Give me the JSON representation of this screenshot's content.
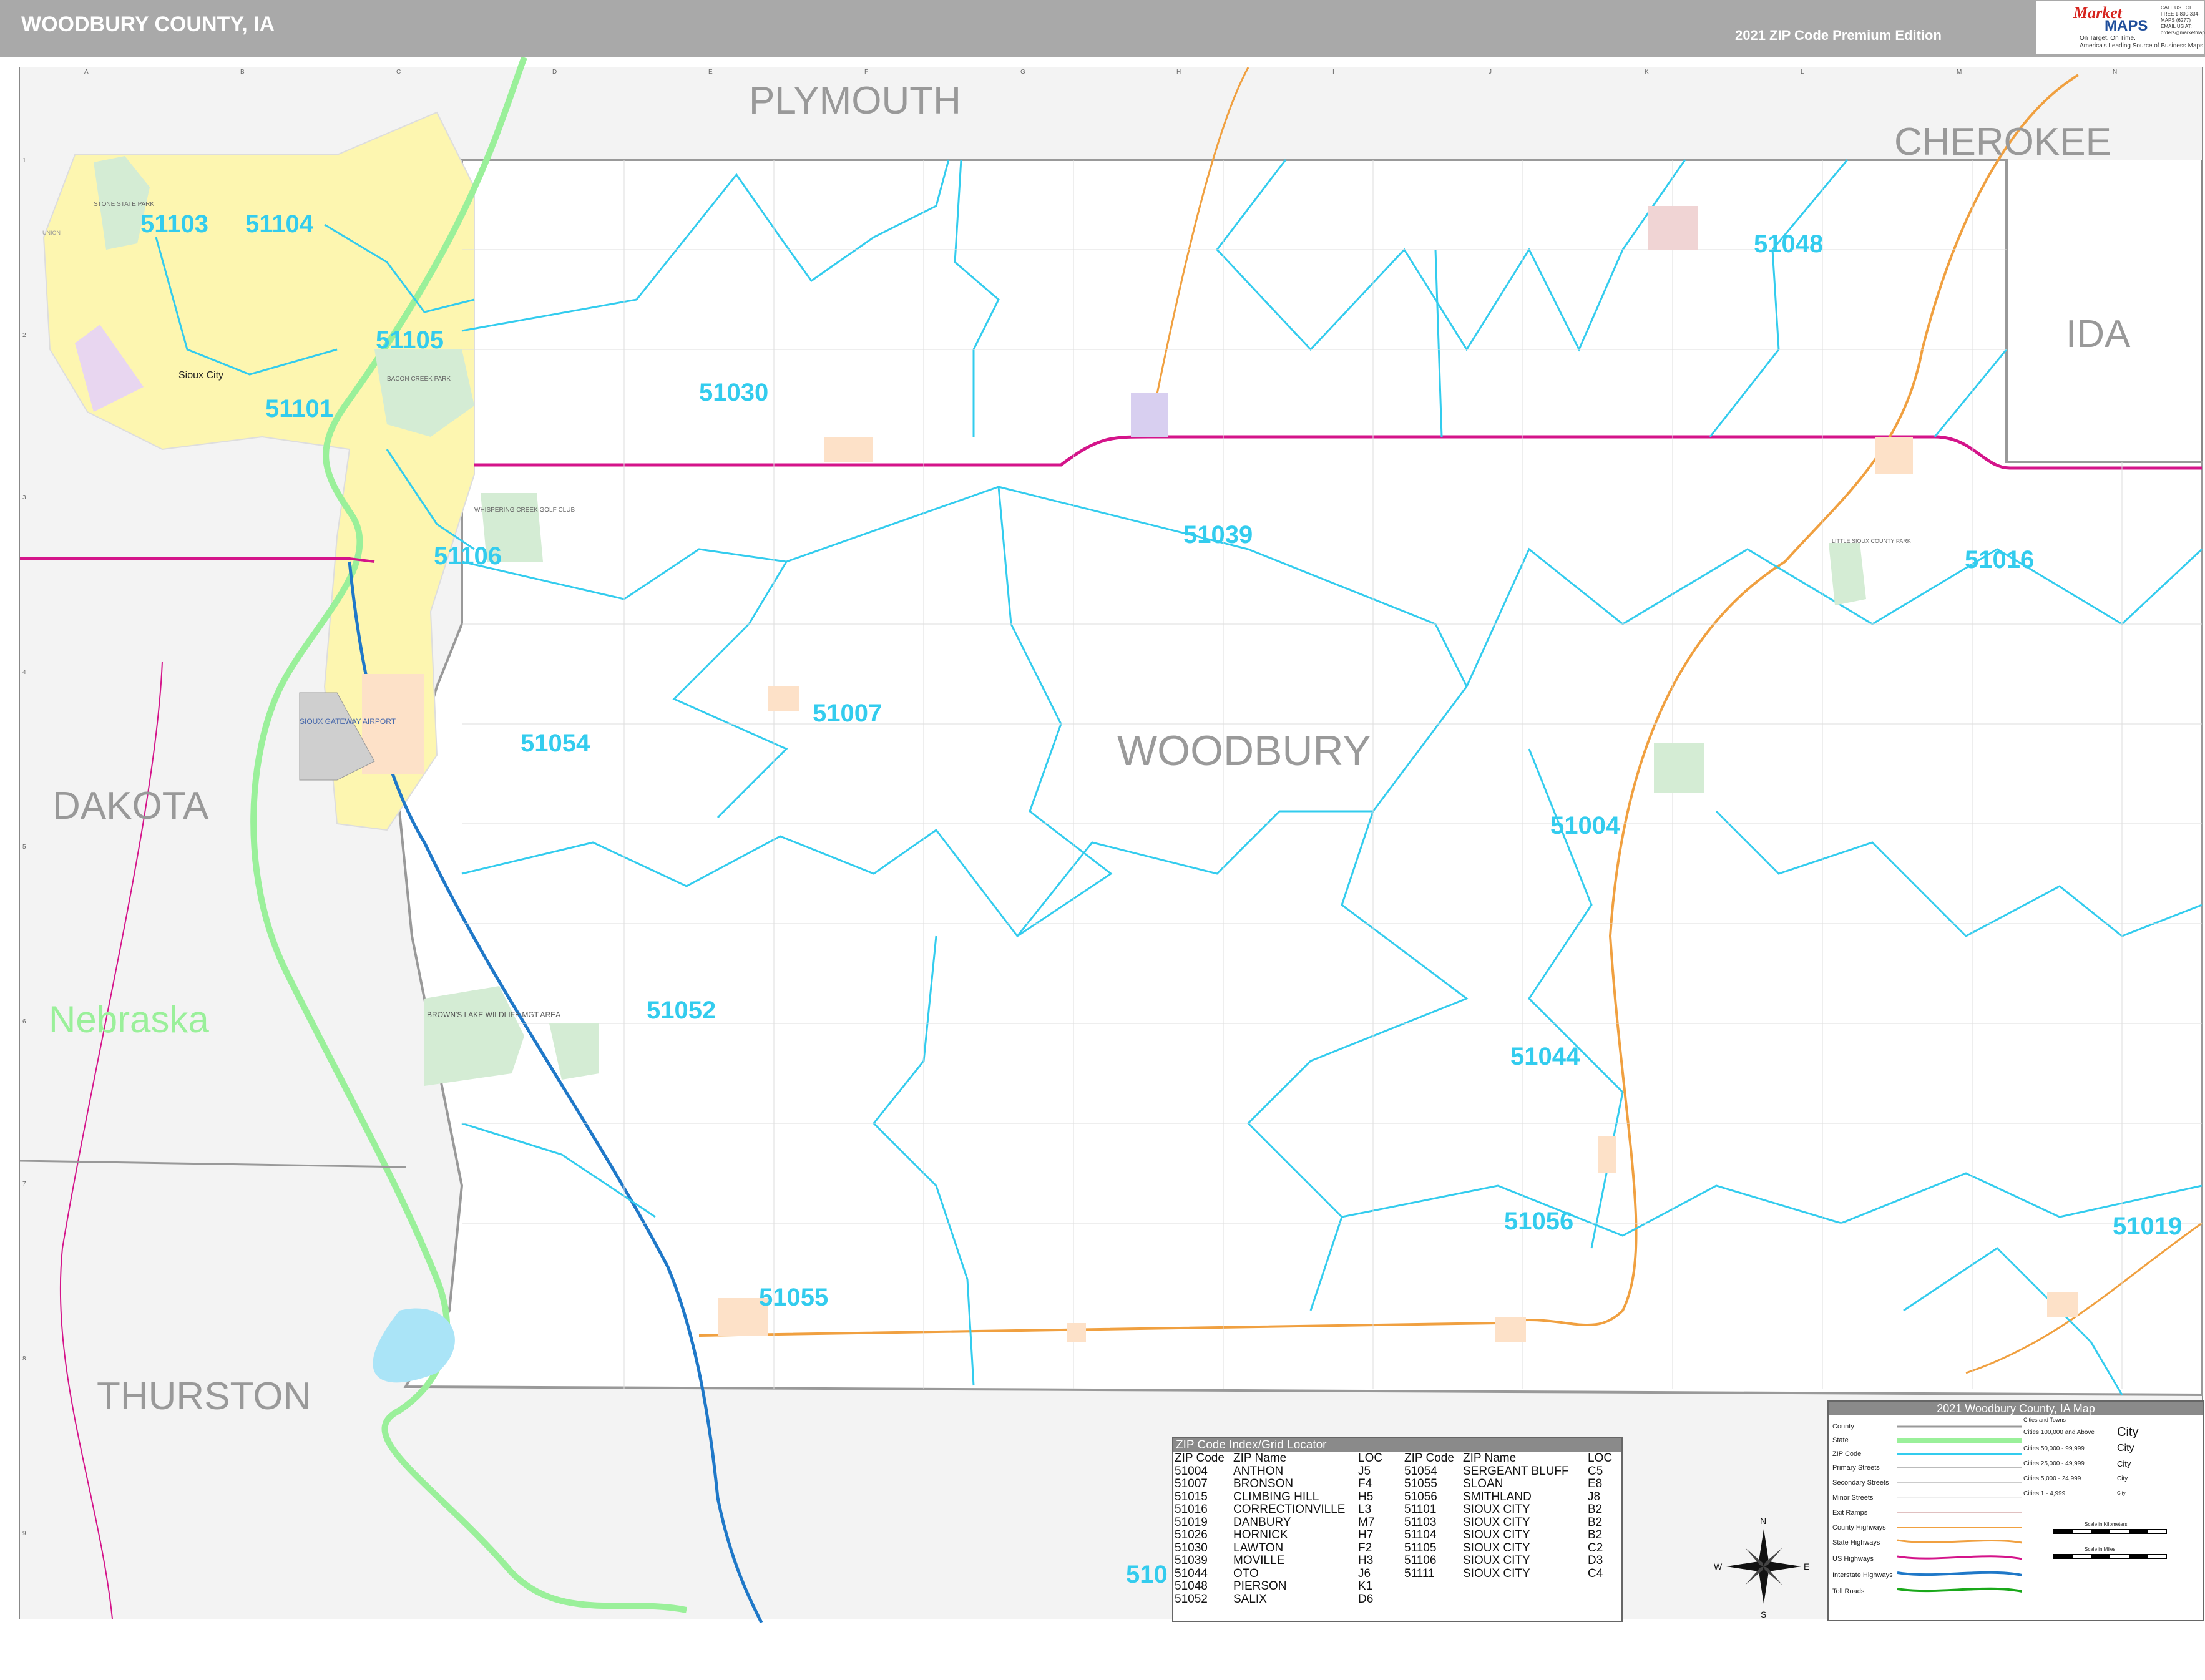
{
  "header": {
    "title": "WOODBURY COUNTY, IA",
    "edition": "2021 ZIP Code Premium Edition"
  },
  "logo": {
    "brand_top": "Market",
    "brand_bottom": "MAPS",
    "tagline1": "On Target.  On Time.",
    "tagline2": "America's Leading Source of Business Maps",
    "contact": "CALL US TOLL FREE 1-800-334-MAPS (6277) EMAIL US AT: orders@marketmaps.com"
  },
  "grid": {
    "columns": [
      "A",
      "B",
      "C",
      "D",
      "E",
      "F",
      "G",
      "H",
      "I",
      "J",
      "K",
      "L",
      "M",
      "N"
    ],
    "rows": [
      "1",
      "2",
      "3",
      "4",
      "5",
      "6",
      "7",
      "8",
      "9"
    ]
  },
  "counties": {
    "plymouth": "PLYMOUTH",
    "cherokee": "CHEROKEE",
    "ida": "IDA",
    "dakota": "DAKOTA",
    "thurston": "THURSTON",
    "woodbury": "WOODBURY"
  },
  "state_label": "Nebraska",
  "places": {
    "sioux_city": "Sioux City",
    "stone_park": "STONE STATE PARK",
    "bacon_creek": "BACON CREEK PARK",
    "whispering_creek": "WHISPERING CREEK GOLF CLUB",
    "airport": "SIOUX GATEWAY AIRPORT",
    "browns_lake": "BROWN'S LAKE WILDLIFE MGT AREA",
    "little_sioux": "LITTLE SIOUX COUNTY PARK",
    "union": "UNION"
  },
  "zip_labels": {
    "z51103": "51103",
    "z51104": "51104",
    "z51105": "51105",
    "z51101": "51101",
    "z51106": "51106",
    "z51030": "51030",
    "z51048": "51048",
    "z51039": "51039",
    "z51016": "51016",
    "z51007": "51007",
    "z51054": "51054",
    "z51004": "51004",
    "z51052": "51052",
    "z51044": "51044",
    "z51056": "51056",
    "z51019": "51019",
    "z51055": "51055",
    "z510": "510"
  },
  "zip_table": {
    "title": "ZIP Code Index/Grid Locator",
    "headers": [
      "ZIP Code",
      "ZIP Name",
      "LOC",
      "ZIP Code",
      "ZIP Name",
      "LOC"
    ],
    "left": [
      [
        "51004",
        "ANTHON",
        "J5"
      ],
      [
        "51007",
        "BRONSON",
        "F4"
      ],
      [
        "51015",
        "CLIMBING HILL",
        "H5"
      ],
      [
        "51016",
        "CORRECTIONVILLE",
        "L3"
      ],
      [
        "51019",
        "DANBURY",
        "M7"
      ],
      [
        "51026",
        "HORNICK",
        "H7"
      ],
      [
        "51030",
        "LAWTON",
        "F2"
      ],
      [
        "51039",
        "MOVILLE",
        "H3"
      ],
      [
        "51044",
        "OTO",
        "J6"
      ],
      [
        "51048",
        "PIERSON",
        "K1"
      ],
      [
        "51052",
        "SALIX",
        "D6"
      ]
    ],
    "right": [
      [
        "51054",
        "SERGEANT BLUFF",
        "C5"
      ],
      [
        "51055",
        "SLOAN",
        "E8"
      ],
      [
        "51056",
        "SMITHLAND",
        "J8"
      ],
      [
        "51101",
        "SIOUX CITY",
        "B2"
      ],
      [
        "51103",
        "SIOUX CITY",
        "B2"
      ],
      [
        "51104",
        "SIOUX CITY",
        "B2"
      ],
      [
        "51105",
        "SIOUX CITY",
        "C2"
      ],
      [
        "51106",
        "SIOUX CITY",
        "D3"
      ],
      [
        "51111",
        "SIOUX CITY",
        "C4"
      ]
    ]
  },
  "legend": {
    "title": "2021 Woodbury County, IA Map",
    "items": [
      "County",
      "State",
      "ZIP Code",
      "Primary Streets",
      "Secondary Streets",
      "Minor Streets",
      "Exit Ramps",
      "County Highways",
      "State Highways",
      "US Highways",
      "Interstate Highways",
      "Toll Roads"
    ],
    "cities_title": "Cities and Towns",
    "cities": [
      {
        "range": "Cities 100,000 and Above",
        "sample": "City"
      },
      {
        "range": "Cities 50,000 - 99,999",
        "sample": "City"
      },
      {
        "range": "Cities 25,000 - 49,999",
        "sample": "City"
      },
      {
        "range": "Cities 5,000 - 24,999",
        "sample": "City"
      },
      {
        "range": "Cities 1 - 4,999",
        "sample": "City"
      }
    ],
    "scale_km": "Scale in Kilometers",
    "scale_mi": "Scale in Miles"
  },
  "compass": {
    "n": "N",
    "s": "S",
    "e": "E",
    "w": "W"
  },
  "colors": {
    "header": "#a9a9a9",
    "zip_boundary": "#33ccee",
    "state_boundary": "#9af09a",
    "interstate": "#1f78c8",
    "us_highway": "#d4148a",
    "county_highway": "#f0a040",
    "city_yellow": "#fdf6b0"
  }
}
